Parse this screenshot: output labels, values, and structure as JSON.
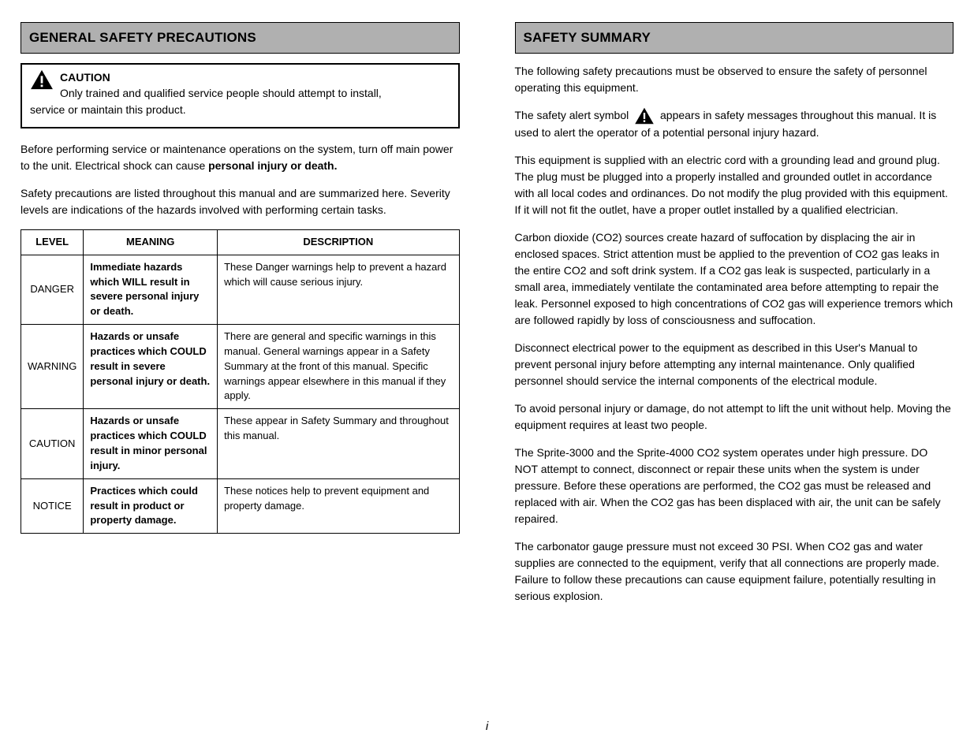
{
  "left": {
    "header": "GENERAL SAFETY PRECAUTIONS",
    "caution": {
      "label": "CAUTION",
      "line1": "Only trained and qualified service people should attempt to install,",
      "line2": "service or maintain this product."
    },
    "para1": "Before performing service or maintenance operations on the system, turn off main power to  the  unit.  Electrical  shock  can  cause ",
    "para1_bold": "personal  injury  or death.",
    "para2": "Safety precautions are listed throughout this manual and are summarized here. Severity levels are indications of the hazards involved with  performing  certain  tasks.",
    "table": {
      "headers": [
        "LEVEL",
        "MEANING",
        "DESCRIPTION"
      ],
      "rows": [
        {
          "level": "DANGER",
          "meaning": "Immediate hazards which WILL result in severe personal injury or death.",
          "description": "These Danger warnings help to prevent a hazard which will cause serious injury."
        },
        {
          "level": "WARNING",
          "meaning": "Hazards or unsafe practices which COULD result in severe personal injury or death.",
          "description": "There are general and specific warnings in this manual. General warnings appear in a Safety Summary at the front of this manual. Specific warnings appear elsewhere in this manual if they apply."
        },
        {
          "level": "CAUTION",
          "meaning": "Hazards or unsafe practices which COULD result in minor personal injury.",
          "description": "These appear in Safety Summary and throughout this manual."
        },
        {
          "level": "NOTICE",
          "meaning": "Practices which could result in product or property damage.",
          "description": "These notices help to prevent equipment and property damage."
        }
      ]
    }
  },
  "right": {
    "header": "SAFETY SUMMARY",
    "intro": "The following safety precautions must be observed to ensure the safety of personnel operating this equipment.",
    "alert_line_pre": "The safety alert symbol ",
    "alert_line_post": "  appears   in safety  messages  throughout  this",
    "alert_line2": "manual. It  is  used  to  alert  the  operator  of  a  potential  personal  injury  hazard.",
    "p1": "This  equipment  is  supplied with  an  electric  cord  with  a  grounding  lead and ground plug. The plug must be plugged into a properly installed and grounded  outlet  in  accordance  with  all  local  codes  and  ordinances. Do not modify the plug provided with this equipment. If it will not fit the outlet, have a proper outlet installed by a qualified electrician.",
    "p2": "Carbon dioxide (CO2) sources create hazard of suffocation by displacing  the  air  in  enclosed  spaces.  Strict  attention  must  be  applied  to  the prevention of CO2 gas leaks in the entire CO2 and soft drink system. If a CO2 gas leak is suspected, particularly in a small area, immediately ventilate the contaminated area before attempting to repair the leak. Personnel exposed to high concentrations of CO2 gas will experience tremors  which  are  followed  rapidly  by  loss  of  consciousness  and  suffocation.",
    "p3": "Disconnect electrical power to the equipment as described in this User's Manual  to  prevent  personal  injury  before  attempting  any  internal maintenance. Only qualified personnel  should service  the internal  components of the electrical module.",
    "p4": "To  avoid  personal  injury  or  damage,  do  not  attempt  to  lift  the  unit without help. Moving the equipment requires at least two people.",
    "p5": "The Sprite-3000 and the Sprite-4000 CO2 system operates under high pressure.  DO  NOT  attempt  to  connect,  disconnect  or  repair  these  units when  the  system  is  under  pressure.  Before  these  operations  are  performed, the CO2 gas must be released and replaced with air. When the CO2 gas has been displaced with air, the unit can be safely repaired.",
    "p6": "The carbonator gauge pressure must not exceed 30 PSI. When CO2 gas and water supplies are connected to the equipment, verify that all connections are properly made. Failure to follow these precautions can cause equipment failure, potentially resulting in serious explosion."
  },
  "footer": "i"
}
